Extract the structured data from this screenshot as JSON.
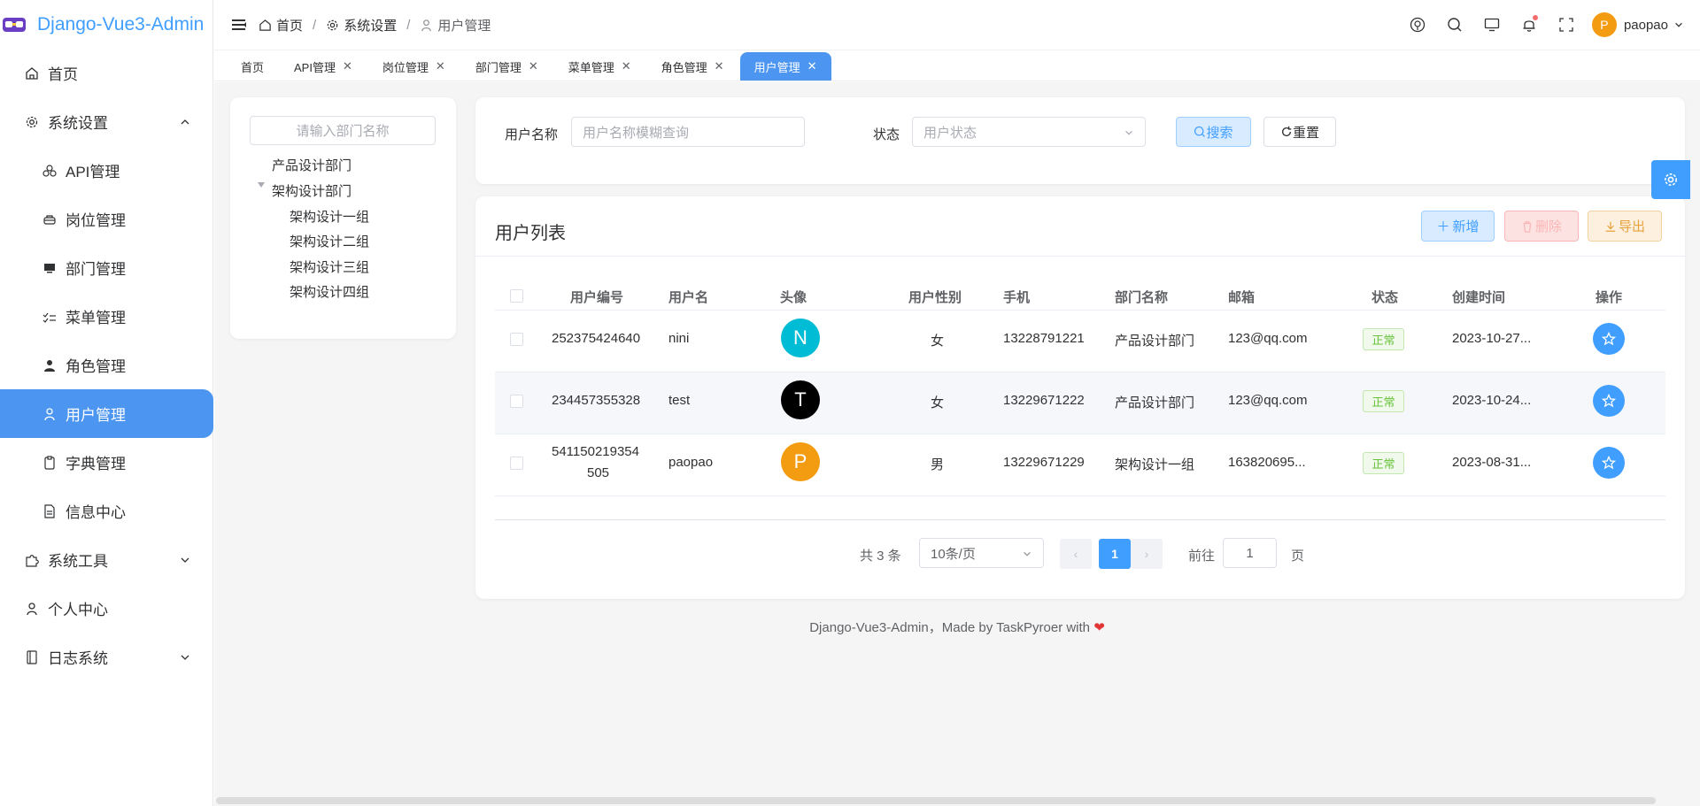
{
  "app": {
    "title": "Django-Vue3-Admin"
  },
  "sidebar": {
    "items": [
      {
        "label": "首页",
        "icon": "home-icon"
      },
      {
        "label": "系统设置",
        "icon": "gear-icon",
        "expanded": true
      },
      {
        "label": "API管理",
        "icon": "api-icon"
      },
      {
        "label": "岗位管理",
        "icon": "position-icon"
      },
      {
        "label": "部门管理",
        "icon": "monitor-icon"
      },
      {
        "label": "菜单管理",
        "icon": "list-check-icon"
      },
      {
        "label": "角色管理",
        "icon": "person-filled-icon"
      },
      {
        "label": "用户管理",
        "icon": "user-icon",
        "active": true
      },
      {
        "label": "字典管理",
        "icon": "clipboard-icon"
      },
      {
        "label": "信息中心",
        "icon": "document-icon"
      },
      {
        "label": "系统工具",
        "icon": "puzzle-icon"
      },
      {
        "label": "个人中心",
        "icon": "user-outline-icon"
      },
      {
        "label": "日志系统",
        "icon": "notebook-icon"
      }
    ]
  },
  "header": {
    "breadcrumb": [
      "首页",
      "系统设置",
      "用户管理"
    ],
    "username": "paopao",
    "avatar_letter": "P"
  },
  "tabs": [
    {
      "label": "首页",
      "closable": false
    },
    {
      "label": "API管理",
      "closable": true
    },
    {
      "label": "岗位管理",
      "closable": true
    },
    {
      "label": "部门管理",
      "closable": true
    },
    {
      "label": "菜单管理",
      "closable": true
    },
    {
      "label": "角色管理",
      "closable": true
    },
    {
      "label": "用户管理",
      "closable": true,
      "active": true
    }
  ],
  "dept_tree": {
    "search_placeholder": "请输入部门名称",
    "nodes": [
      "产品设计部门",
      "架构设计部门",
      "架构设计一组",
      "架构设计二组",
      "架构设计三组",
      "架构设计四组"
    ]
  },
  "filter": {
    "username_label": "用户名称",
    "username_placeholder": "用户名称模糊查询",
    "status_label": "状态",
    "status_placeholder": "用户状态",
    "search_label": "搜索",
    "reset_label": "重置"
  },
  "user_list": {
    "title": "用户列表",
    "add_label": "新增",
    "delete_label": "删除",
    "export_label": "导出",
    "columns": [
      "用户编号",
      "用户名",
      "头像",
      "用户性别",
      "手机",
      "部门名称",
      "邮箱",
      "状态",
      "创建时间",
      "操作"
    ],
    "rows": [
      {
        "id": "252375424640",
        "username": "nini",
        "avatar_letter": "N",
        "avatar_color": "#00bcd4",
        "gender": "女",
        "phone": "13228791221",
        "dept": "产品设计部门",
        "email": "123@qq.com",
        "status": "正常",
        "created": "2023-10-27..."
      },
      {
        "id": "234457355328",
        "username": "test",
        "avatar_letter": "T",
        "avatar_color": "#000000",
        "gender": "女",
        "phone": "13229671222",
        "dept": "产品设计部门",
        "email": "123@qq.com",
        "status": "正常",
        "created": "2023-10-24..."
      },
      {
        "id_line1": "541150219354",
        "id_line2": "505",
        "username": "paopao",
        "avatar_letter": "P",
        "avatar_color": "#f39c12",
        "gender": "男",
        "phone": "13229671229",
        "dept": "架构设计一组",
        "email": "163820695...",
        "status": "正常",
        "created": "2023-08-31..."
      }
    ]
  },
  "pagination": {
    "total": "共 3 条",
    "page_size": "10条/页",
    "current": "1",
    "goto_label": "前往",
    "goto_value": "1",
    "page_suffix": "页"
  },
  "footer": {
    "text": "Django-Vue3-Admin，Made by TaskPyroer with",
    "heart": "❤"
  },
  "colors": {
    "primary": "#409eff",
    "active_menu": "#4c95f0"
  }
}
